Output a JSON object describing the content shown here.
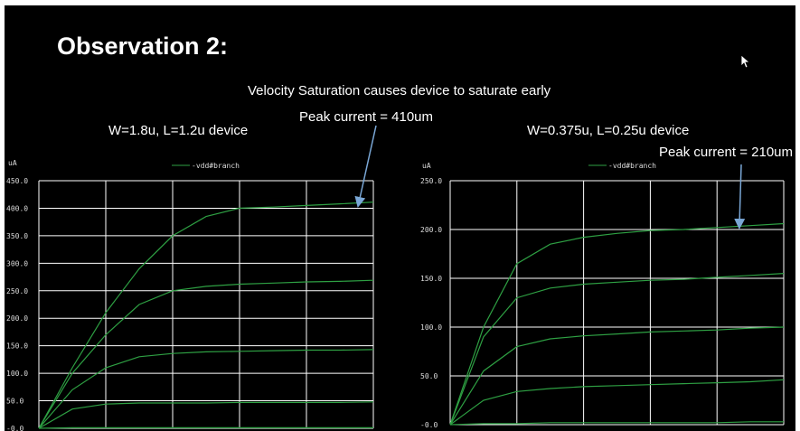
{
  "slide": {
    "title": "Observation 2:",
    "annotation_velocity": "Velocity Saturation causes device to saturate early",
    "left_device_label": "W=1.8u, L=1.2u device",
    "left_peak_label": "Peak current = 410um",
    "right_device_label": "W=0.375u, L=0.25u device",
    "right_peak_label": "Peak current = 210um"
  },
  "colors": {
    "background": "#000000",
    "grid": "#ffffff",
    "trace": "#2ea043",
    "arrow": "#7aa7d6",
    "text": "#ffffff"
  },
  "icons": {
    "cursor": "mouse-pointer-icon"
  },
  "chart_data": [
    {
      "type": "line",
      "ylabel": "uA",
      "legend": "-vdd#branch",
      "legend_placement": "top",
      "ylim": [
        0,
        450
      ],
      "yticks": [
        "450.0",
        "400.0",
        "350.0",
        "300.0",
        "250.0",
        "200.0",
        "150.0",
        "100.0",
        "50.0",
        "-0.0"
      ],
      "x": [
        0,
        0.1,
        0.2,
        0.3,
        0.4,
        0.5,
        0.6,
        0.7,
        0.8,
        0.9,
        1.0
      ],
      "series": [
        {
          "values": [
            0,
            110,
            210,
            290,
            350,
            385,
            400,
            402,
            405,
            408,
            411
          ]
        },
        {
          "values": [
            0,
            100,
            170,
            225,
            250,
            258,
            262,
            264,
            266,
            267,
            269
          ]
        },
        {
          "values": [
            0,
            70,
            110,
            130,
            136,
            139,
            140,
            141,
            142,
            142,
            143
          ]
        },
        {
          "values": [
            0,
            35,
            44,
            46,
            46,
            46,
            47,
            47,
            47,
            47,
            48
          ]
        },
        {
          "values": [
            0,
            1,
            1,
            1,
            1,
            1,
            1,
            1,
            1,
            1,
            1
          ]
        }
      ]
    },
    {
      "type": "line",
      "ylabel": "uA",
      "legend": "-vdd#branch",
      "legend_placement": "top",
      "ylim": [
        0,
        250
      ],
      "yticks": [
        "250.0",
        "200.0",
        "150.0",
        "100.0",
        "50.0",
        "-0.0"
      ],
      "x": [
        0,
        0.1,
        0.2,
        0.3,
        0.4,
        0.5,
        0.6,
        0.7,
        0.8,
        0.9,
        1.0
      ],
      "series": [
        {
          "values": [
            0,
            100,
            165,
            185,
            192,
            196,
            199,
            200,
            202,
            204,
            206
          ]
        },
        {
          "values": [
            0,
            90,
            130,
            140,
            144,
            146,
            148,
            149,
            151,
            153,
            155
          ]
        },
        {
          "values": [
            0,
            55,
            80,
            88,
            91,
            93,
            95,
            96,
            97,
            99,
            100
          ]
        },
        {
          "values": [
            0,
            25,
            34,
            37,
            39,
            40,
            41,
            42,
            43,
            44,
            46
          ]
        },
        {
          "values": [
            0,
            1,
            1,
            2,
            2,
            2,
            2,
            2,
            2,
            3,
            3
          ]
        }
      ]
    }
  ]
}
